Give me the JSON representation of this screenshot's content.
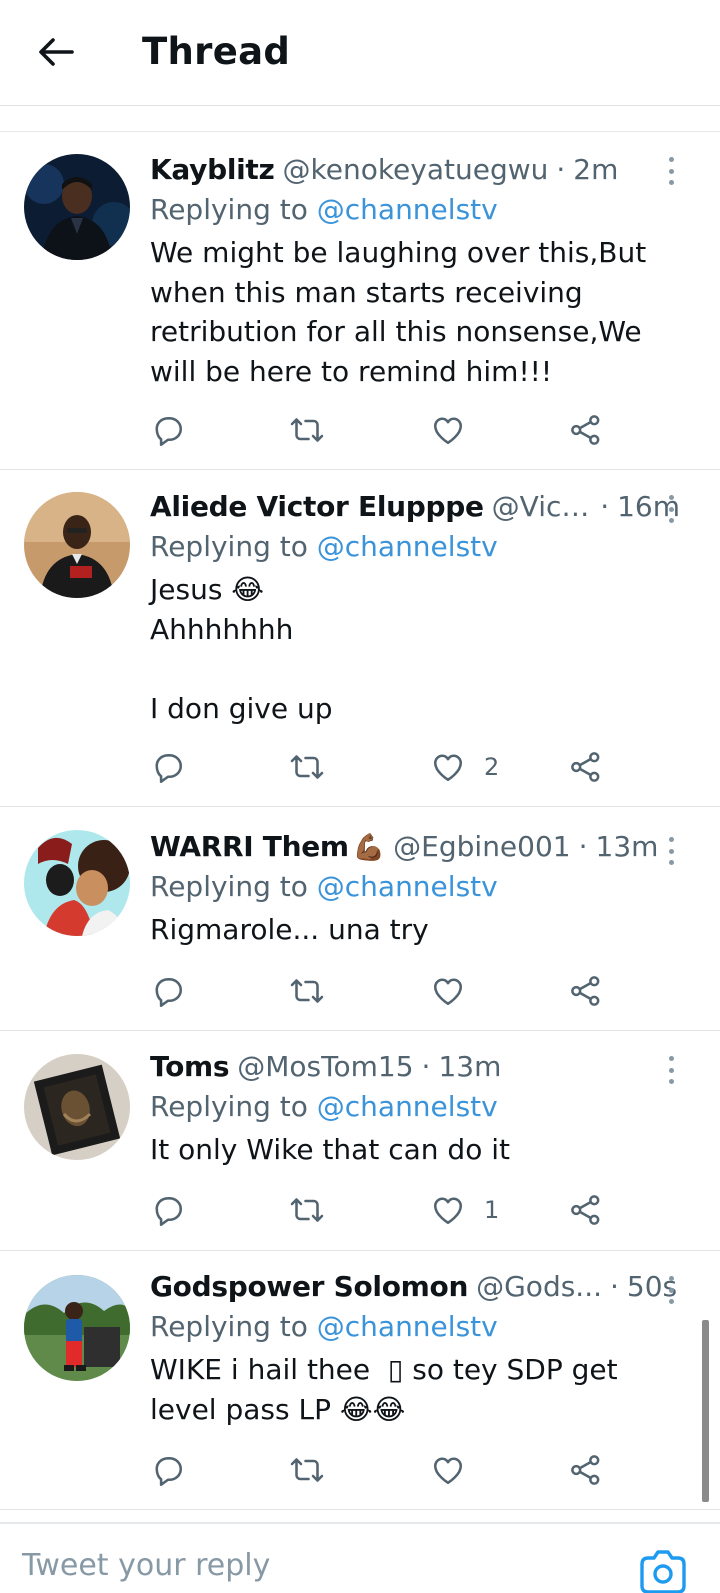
{
  "header": {
    "title": "Thread"
  },
  "tweets": [
    {
      "name": "Kayblitz",
      "name_emoji": "",
      "handle": "@kenokeyatuegwu",
      "time": "2m",
      "reply_prefix": "Replying to ",
      "reply_to": "@channelstv",
      "text": "We might be laughing over this,But when this man starts receiving retribution for all this nonsense,We will be here to remind him!!!",
      "likes": ""
    },
    {
      "name": "Aliede Victor Elupppe",
      "name_emoji": "",
      "handle": "@Vict...",
      "time": "16m",
      "reply_prefix": "Replying to ",
      "reply_to": "@channelstv",
      "text": "Jesus 😂\nAhhhhhhh\n\nI don give up",
      "likes": "2"
    },
    {
      "name": "WARRI Them",
      "name_emoji": "💪🏾",
      "handle": "@Egbine001",
      "time": "13m",
      "reply_prefix": "Replying to ",
      "reply_to": "@channelstv",
      "text": "Rigmarole... una try",
      "likes": ""
    },
    {
      "name": "Toms",
      "name_emoji": "",
      "handle": "@MosTom15",
      "time": "13m",
      "reply_prefix": "Replying to ",
      "reply_to": "@channelstv",
      "text": "It only Wike that can do it",
      "likes": "1"
    },
    {
      "name": "Godspower Solomon",
      "name_emoji": "",
      "handle": "@Gods...",
      "time": "50s",
      "reply_prefix": "Replying to ",
      "reply_to": "@channelstv",
      "text": "WIKE i hail thee  ▯ so tey SDP get level pass LP 😂😂",
      "likes": ""
    }
  ],
  "composer": {
    "placeholder": "Tweet your reply"
  },
  "icons": {
    "back": "arrow-left-icon",
    "more": "more-vertical-icon",
    "reply": "reply-icon",
    "retweet": "retweet-icon",
    "like": "heart-icon",
    "share": "share-icon",
    "camera": "camera-icon"
  },
  "colors": {
    "link": "#3b94d9",
    "secondary_text": "#536471",
    "icon": "#536471"
  }
}
